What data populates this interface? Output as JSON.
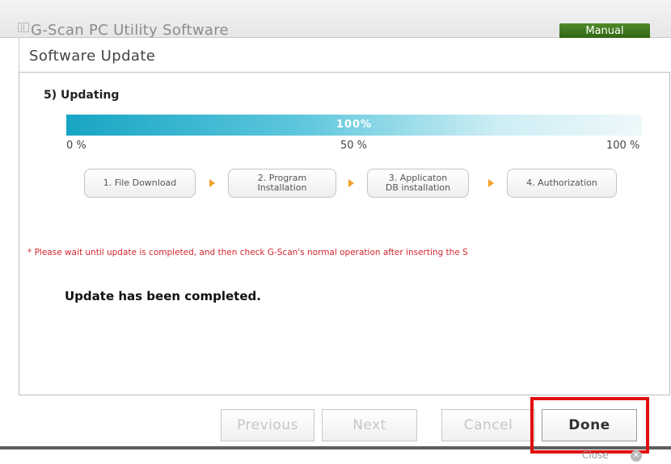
{
  "window": {
    "title": "G-Scan PC Utility Software",
    "manual_label": "Manual"
  },
  "header": {
    "title": "Software Update"
  },
  "step": {
    "heading": "5) Updating"
  },
  "progress": {
    "value_fraction": 1.0,
    "value_text": "100%",
    "scale_start": "0 %",
    "scale_mid": "50 %",
    "scale_end": "100 %"
  },
  "stages": [
    {
      "label": "1. File Download"
    },
    {
      "label": "2. Program\nInstallation"
    },
    {
      "label": "3. Applicaton\nDB installation"
    },
    {
      "label": "4. Authorization"
    }
  ],
  "notice": "* Please wait until update is completed, and then check G-Scan's normal operation after inserting the S",
  "status_message": "Update has been completed.",
  "footer": {
    "previous_label": "Previous",
    "next_label": "Next",
    "cancel_label": "Cancel",
    "done_label": "Done",
    "close_label": "Close"
  },
  "colors": {
    "progress_accent": "#17a5c4",
    "notice_red": "#d32630",
    "highlight_red": "#e01010",
    "manual_green": "#3f7a1c"
  }
}
